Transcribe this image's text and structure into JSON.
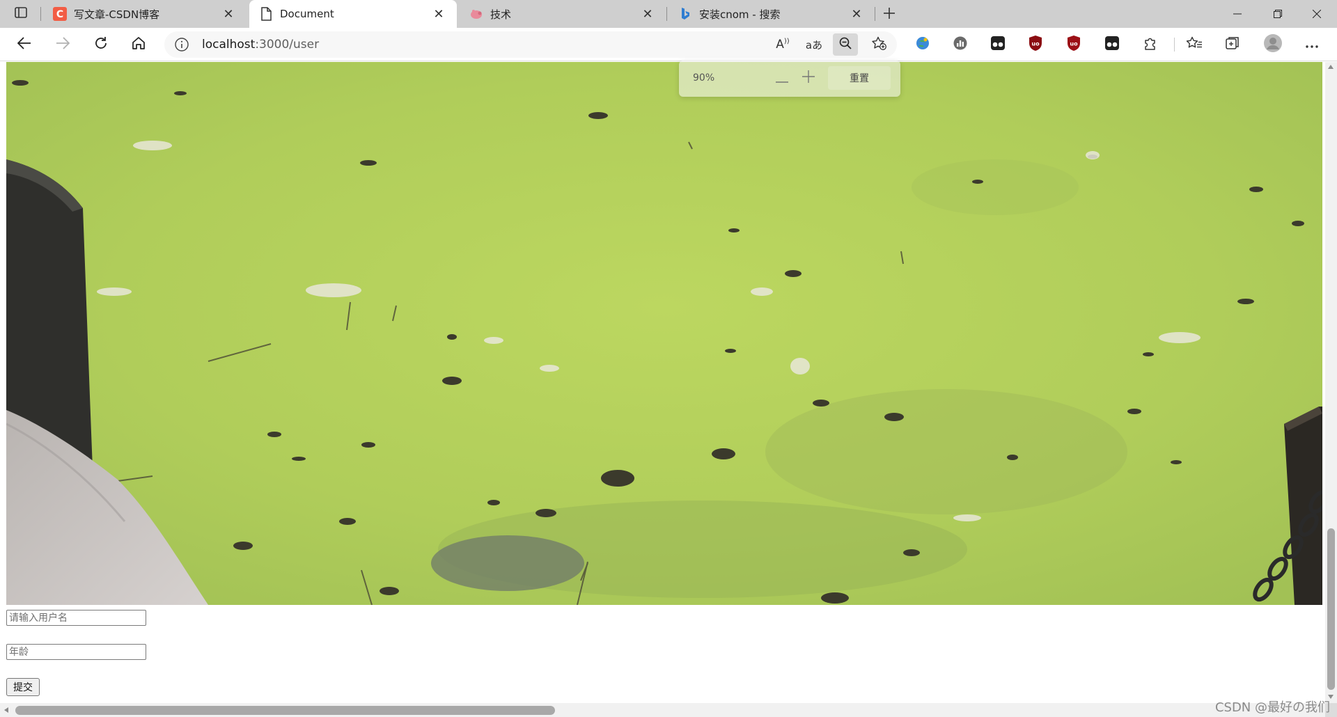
{
  "tabs": [
    {
      "title": "写文章-CSDN博客",
      "favicon": "csdn-c-icon",
      "active": false
    },
    {
      "title": "Document",
      "favicon": "page-icon",
      "active": true
    },
    {
      "title": "技术",
      "favicon": "pig-icon",
      "active": false
    },
    {
      "title": "安装cnom - 搜索",
      "favicon": "bing-icon",
      "active": false
    }
  ],
  "toolbar": {
    "url_host": "localhost",
    "url_path": ":3000/user",
    "read_aloud_label": "A",
    "translate_label": "aあ"
  },
  "zoom_popup": {
    "level": "90%",
    "reset_label": "重置"
  },
  "form": {
    "username_placeholder": "请输入用户名",
    "age_placeholder": "年龄",
    "submit_label": "提交"
  },
  "watermark": "CSDN @最好の我们",
  "colors": {
    "tab_strip": "#cfcfcf",
    "active_tab": "#ffffff",
    "duckweed": "#b2cf5c",
    "scrollbar_thumb": "#a8a8a8"
  }
}
